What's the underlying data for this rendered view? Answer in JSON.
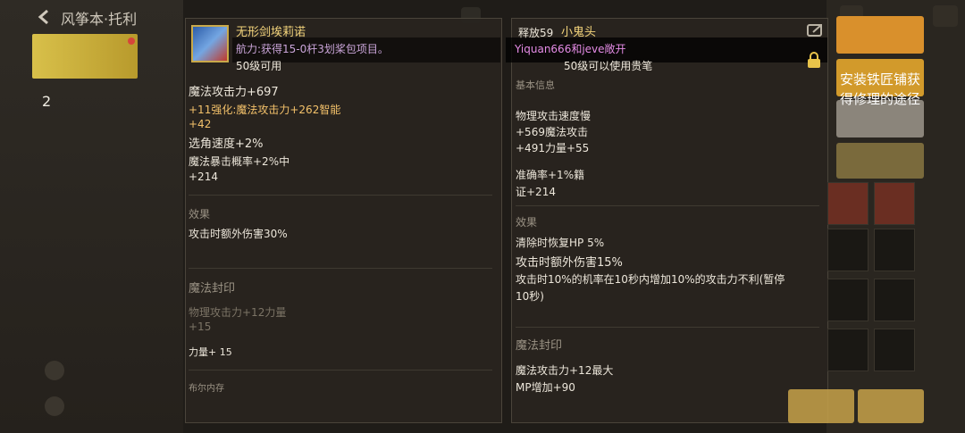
{
  "header": {
    "title": "风筝本·托利"
  },
  "left_panel": {
    "count": "2"
  },
  "tooltip_left": {
    "item_name": "无形剑埃莉诺",
    "subtitle": "航力:获得15-0杆3划桨包项目。",
    "level_req": "50级可用",
    "stats": [
      "魔法攻击力+697",
      "+11强化:魔法攻击力+262智能",
      "+42",
      "选角速度+2%",
      "魔法暴击概率+2%中",
      "+214"
    ],
    "effect_header": "效果",
    "effect_text": "攻击时额外伤害30%",
    "seal_header": "魔法封印",
    "seal_line1": "物理攻击力+12力量",
    "seal_line2": "+15",
    "seal_line3": "力量+ 15",
    "footer_label": "布尔内存"
  },
  "tooltip_right": {
    "tag": "释放59",
    "item_name": "小鬼头",
    "owner": "Yiquan666和jeve敞开",
    "level_req": "50级可以使用贵笔",
    "basic_header": "基本信息",
    "stats": [
      "物理攻击速度慢",
      "+569魔法攻击",
      "+491力量+55",
      "准确率+1%籍",
      "证+214"
    ],
    "effect_header": "效果",
    "effects": [
      "清除时恢复HP 5%",
      "攻击时额外伤害15%",
      "攻击时10%的机率在10秒内增加10%的攻击力不利(暂停",
      "10秒)"
    ],
    "seal_header": "魔法封印",
    "seal_line1": "魔法攻击力+12最大",
    "seal_line2": "MP增加+90"
  },
  "right_panel": {
    "install_label": "安装铁匠铺获得修理的途径"
  },
  "colors": {
    "gold": "#f2d37b",
    "orange_button": "#d9902c",
    "pink": "#e58ce6"
  }
}
